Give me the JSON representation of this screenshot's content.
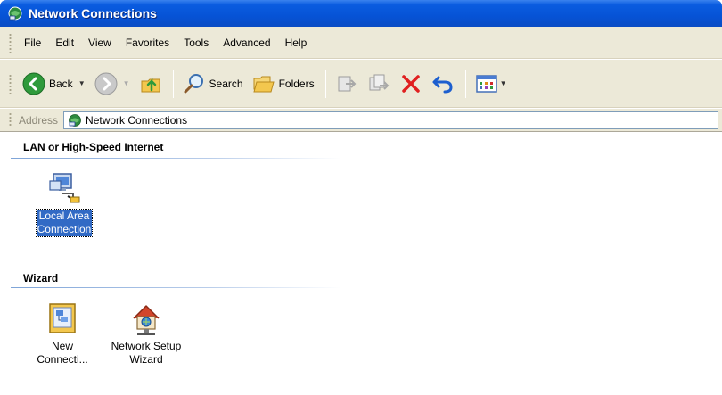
{
  "window": {
    "title": "Network Connections"
  },
  "menu": {
    "items": [
      "File",
      "Edit",
      "View",
      "Favorites",
      "Tools",
      "Advanced",
      "Help"
    ]
  },
  "toolbar": {
    "back_label": "Back",
    "search_label": "Search",
    "folders_label": "Folders"
  },
  "address": {
    "label": "Address",
    "value": "Network Connections"
  },
  "groups": [
    {
      "header": "LAN or High-Speed Internet",
      "items": [
        {
          "label_line1": "Local Area",
          "label_line2": "Connection",
          "icon": "lan-connection-icon",
          "selected": true
        }
      ]
    },
    {
      "header": "Wizard",
      "items": [
        {
          "label_line1": "New",
          "label_line2": "Connecti...",
          "icon": "new-connection-wizard-icon"
        },
        {
          "label_line1": "Network Setup",
          "label_line2": "Wizard",
          "icon": "network-setup-wizard-icon"
        }
      ]
    }
  ],
  "colors": {
    "titlebar": "#0653d6",
    "chrome": "#ece9d8",
    "selection": "#316ac5",
    "delete_red": "#e02020"
  }
}
